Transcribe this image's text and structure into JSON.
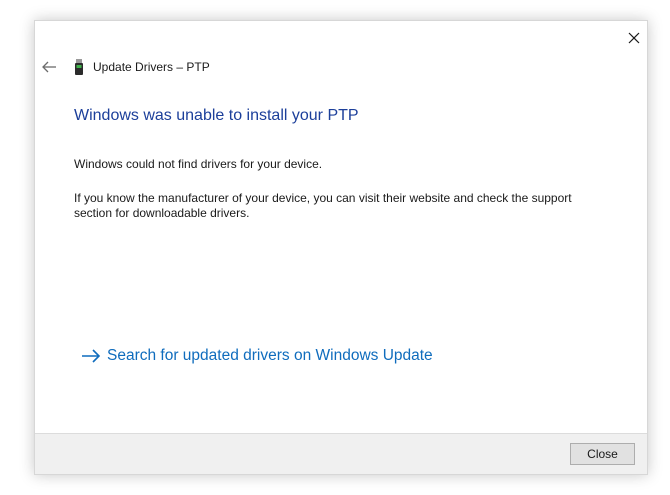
{
  "window": {
    "title": "Update Drivers – PTP",
    "close_icon": "close-icon",
    "back_icon": "back-arrow-icon",
    "device_icon": "usb-device-icon"
  },
  "content": {
    "heading": "Windows was unable to install your PTP",
    "message": "Windows could not find drivers for your device.",
    "details": "If you know the manufacturer of your device, you can visit their website and check the support section for downloadable drivers.",
    "link_icon": "arrow-right-icon",
    "link_label": "Search for updated drivers on Windows Update"
  },
  "footer": {
    "close_label": "Close"
  },
  "colors": {
    "heading": "#1c3f9a",
    "link": "#0f6cbd",
    "footer_bg": "#f0f0f0"
  }
}
